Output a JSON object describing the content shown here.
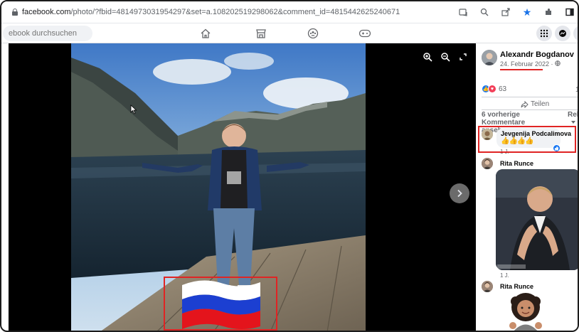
{
  "browser": {
    "url_domain": "facebook.com",
    "url_path": "/photo/?fbid=4814973031954297&set=a.108202519298062&comment_id=4815442625240671",
    "icons": [
      "lock-icon",
      "translate-icon",
      "zoom-icon",
      "share-icon",
      "star-icon",
      "extensions-icon",
      "sidebar-icon"
    ]
  },
  "fbnav": {
    "search_placeholder": "ebook durchsuchen",
    "icons": [
      "home-icon",
      "marketplace-icon",
      "groups-icon",
      "gaming-icon",
      "menu-grid-icon",
      "messenger-icon",
      "notifications-icon"
    ]
  },
  "viewer": {
    "tools": [
      "zoom-in-icon",
      "zoom-out-icon",
      "fullscreen-icon"
    ],
    "next_icon": "chevron-right-icon"
  },
  "post": {
    "author": "Alexandr Bogdanov",
    "date": "24. Februar 2022 ·",
    "privacy_icon": "globe-icon",
    "reaction_count": "63",
    "reaction_count_right": "1",
    "share_label": "Teilen",
    "prev_comments": "6 vorherige Kommentare ansehen",
    "sort_label": "Rele"
  },
  "comments": [
    {
      "name": "Jevgenija Podcalimova",
      "text": "👍👍👍👍",
      "time": "1 J."
    },
    {
      "name": "Rita Runce",
      "time": "1 J."
    },
    {
      "name": "Rita Runce"
    }
  ],
  "colors": {
    "annotation_red": "#e02424",
    "facebook_blue": "#1877f2",
    "flag_white": "#ffffff",
    "flag_blue": "#1c3fd1",
    "flag_red": "#e4141c"
  }
}
